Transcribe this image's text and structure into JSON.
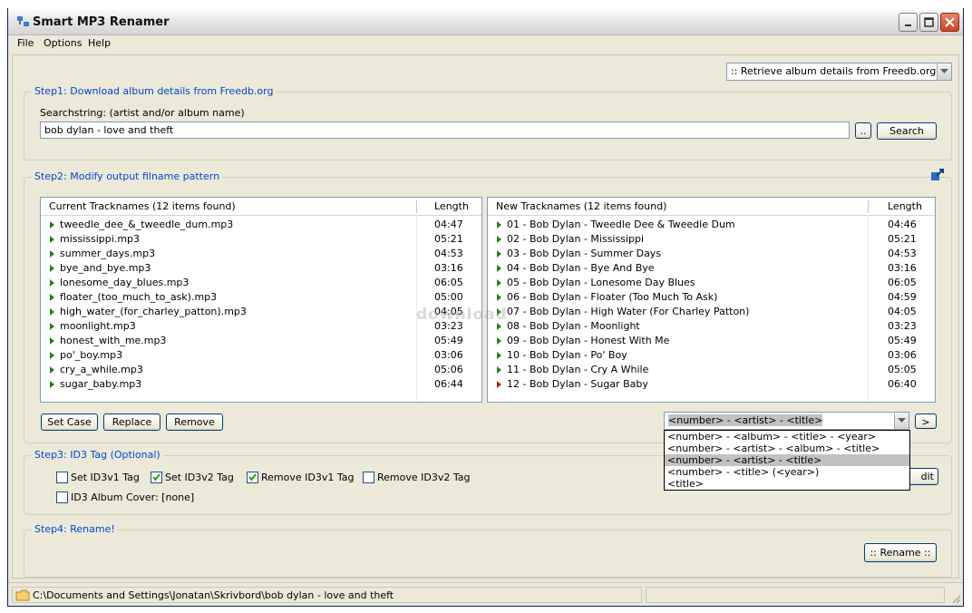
{
  "window": {
    "title": "Smart MP3 Renamer"
  },
  "menu": [
    "File",
    "Options",
    "Help"
  ],
  "source_select": ":: Retrieve album details from Freedb.org ::",
  "step1": {
    "title": "Step1: Download album details from Freedb.org",
    "search_label": "Searchstring: (artist and/or album name)",
    "search_value": "bob dylan - love and theft",
    "browse_label": "..",
    "search_button": "Search"
  },
  "step2": {
    "title": "Step2: Modify output filname pattern",
    "current": {
      "header_name": "Current Tracknames (12 items found)",
      "header_length": "Length",
      "rows": [
        {
          "name": "tweedle_dee_&_tweedle_dum.mp3",
          "length": "04:47"
        },
        {
          "name": "mississippi.mp3",
          "length": "05:21"
        },
        {
          "name": "summer_days.mp3",
          "length": "04:53"
        },
        {
          "name": "bye_and_bye.mp3",
          "length": "03:16"
        },
        {
          "name": "lonesome_day_blues.mp3",
          "length": "06:05"
        },
        {
          "name": "floater_(too_much_to_ask).mp3",
          "length": "05:00"
        },
        {
          "name": "high_water_(for_charley_patton).mp3",
          "length": "04:05"
        },
        {
          "name": "moonlight.mp3",
          "length": "03:23"
        },
        {
          "name": "honest_with_me.mp3",
          "length": "05:49"
        },
        {
          "name": "po'_boy.mp3",
          "length": "03:06"
        },
        {
          "name": "cry_a_while.mp3",
          "length": "05:06"
        },
        {
          "name": "sugar_baby.mp3",
          "length": "06:44"
        }
      ]
    },
    "new": {
      "header_name": "New Tracknames (12 items found)",
      "header_length": "Length",
      "rows": [
        {
          "name": "01 - Bob Dylan - Tweedle Dee & Tweedle Dum",
          "length": "04:46"
        },
        {
          "name": "02 - Bob Dylan - Mississippi",
          "length": "05:21"
        },
        {
          "name": "03 - Bob Dylan - Summer Days",
          "length": "04:53"
        },
        {
          "name": "04 - Bob Dylan - Bye And Bye",
          "length": "03:16"
        },
        {
          "name": "05 - Bob Dylan - Lonesome Day Blues",
          "length": "06:05"
        },
        {
          "name": "06 - Bob Dylan - Floater (Too Much To Ask)",
          "length": "04:59"
        },
        {
          "name": "07 - Bob Dylan - High Water (For Charley Patton)",
          "length": "04:05"
        },
        {
          "name": "08 - Bob Dylan - Moonlight",
          "length": "03:23"
        },
        {
          "name": "09 - Bob Dylan - Honest With Me",
          "length": "05:49"
        },
        {
          "name": "10 - Bob Dylan - Po' Boy",
          "length": "03:06"
        },
        {
          "name": "11 - Bob Dylan - Cry A While",
          "length": "05:05"
        },
        {
          "name": "12 - Bob Dylan - Sugar Baby",
          "length": "06:40"
        }
      ]
    },
    "set_case": "Set Case",
    "replace": "Replace",
    "remove": "Remove",
    "pattern_selected": "<number> - <artist> - <title>",
    "apply_label": ">",
    "pattern_options": [
      "<number> - <album> - <title> - <year>",
      "<number> - <artist> - <album> - <title>",
      "<number> - <artist> - <title>",
      "<number> - <title> (<year>)",
      "<title>"
    ],
    "selected_option_index": 2
  },
  "step3": {
    "title": "Step3: ID3 Tag (Optional)",
    "set_id3v1": {
      "label": "Set ID3v1 Tag",
      "checked": false
    },
    "set_id3v2": {
      "label": "Set ID3v2 Tag",
      "checked": true
    },
    "remove_id3v1": {
      "label": "Remove ID3v1 Tag",
      "checked": true
    },
    "remove_id3v2": {
      "label": "Remove ID3v2 Tag",
      "checked": false
    },
    "album_cover": {
      "label": "ID3 Album Cover: [none]",
      "checked": false
    },
    "edit_label": "dit"
  },
  "step4": {
    "title": "Step4: Rename!",
    "rename_button": ":: Rename ::"
  },
  "status": {
    "path": "C:\\Documents and Settings\\Jonatan\\Skrivbord\\bob dylan - love and theft"
  },
  "watermark": "download"
}
